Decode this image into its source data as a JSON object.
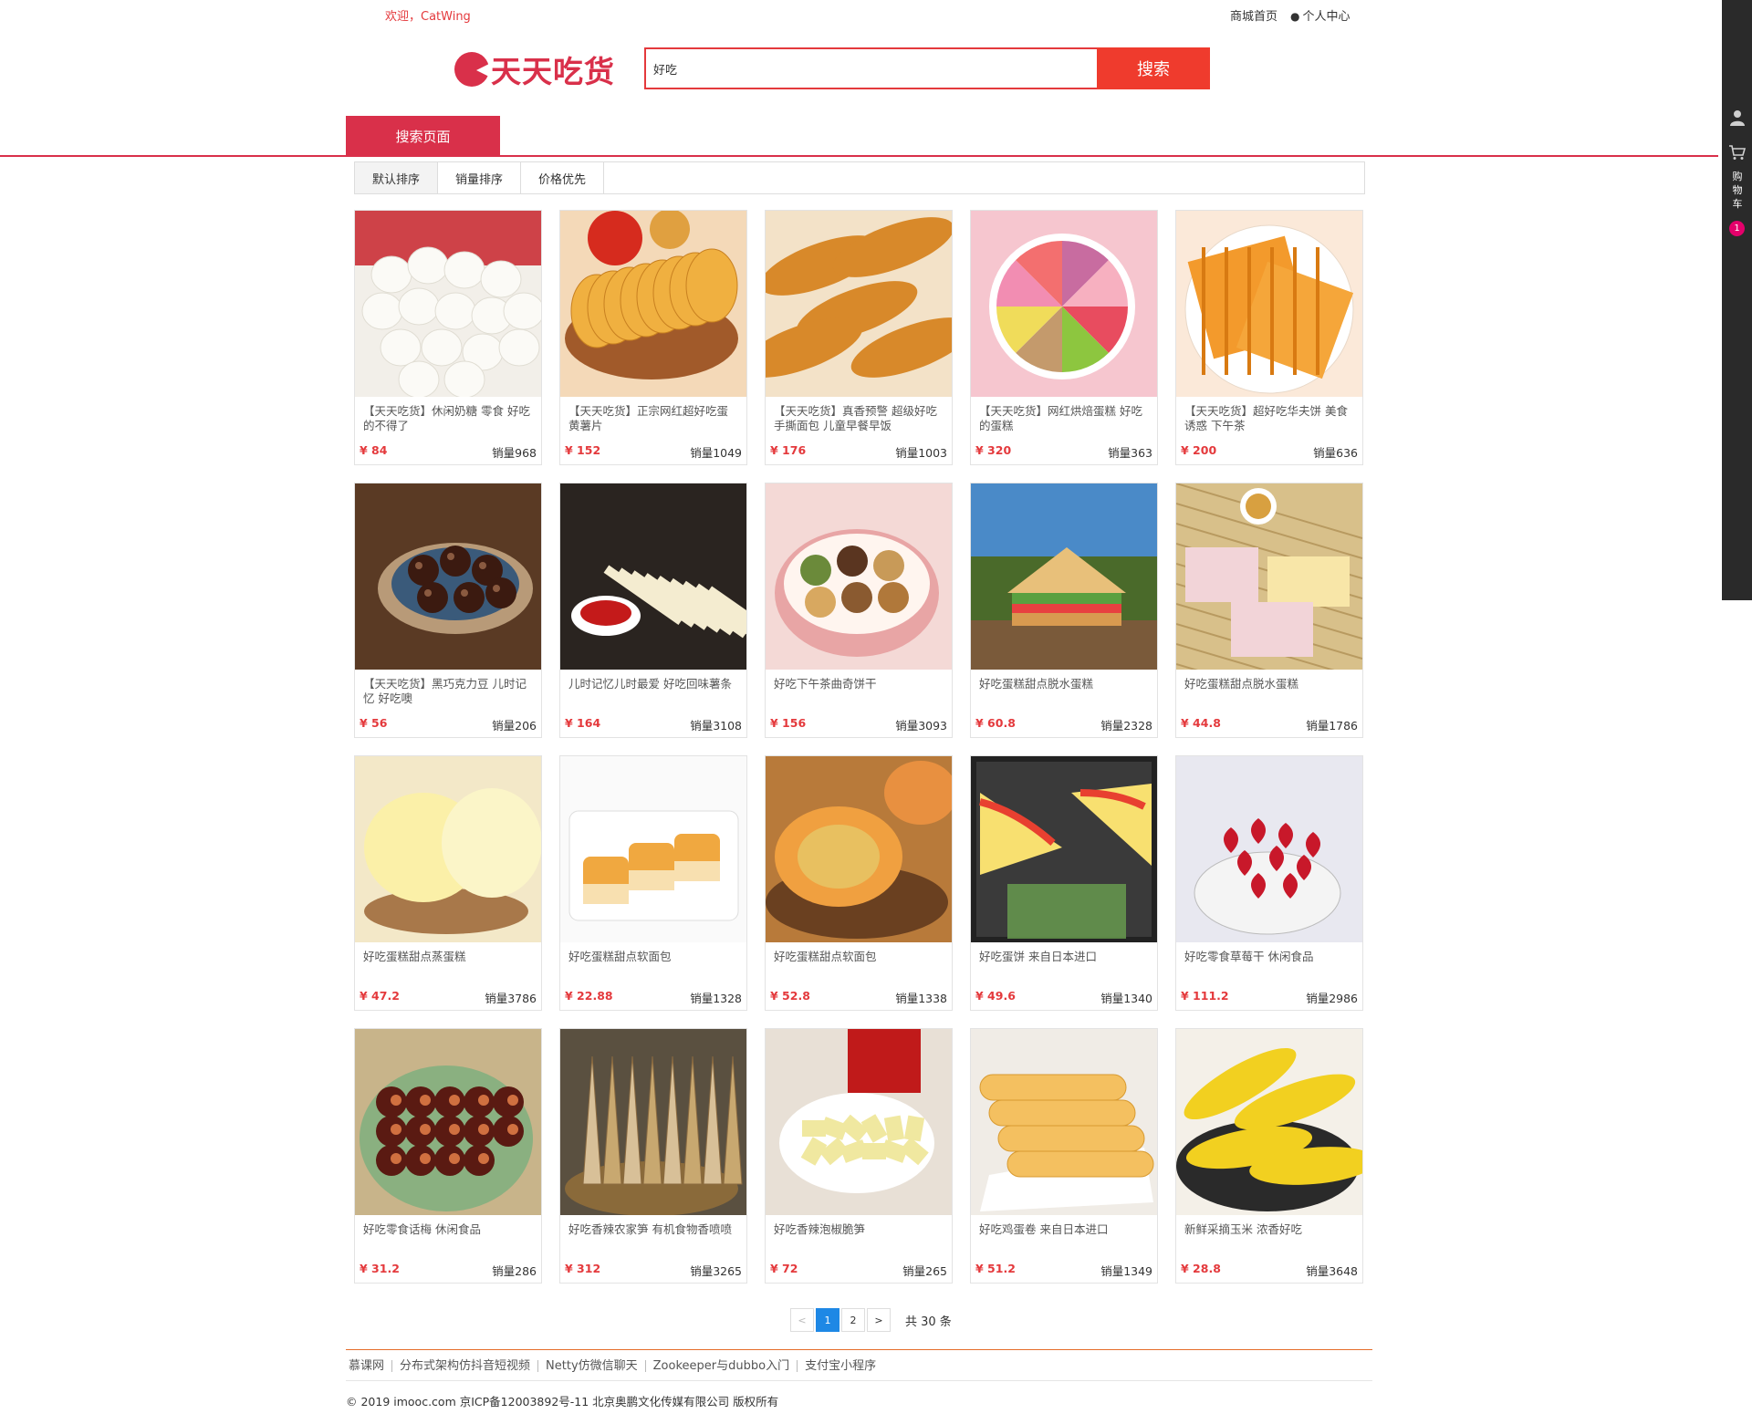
{
  "header": {
    "welcome": "欢迎，CatWing",
    "home_link": "商城首页",
    "user_center": "个人中心",
    "logo_text": "天天吃货"
  },
  "search": {
    "value": "好吃",
    "button_label": "搜索"
  },
  "nav": {
    "tab_label": "搜索页面"
  },
  "sort": {
    "options": [
      "默认排序",
      "销量排序",
      "价格优先"
    ],
    "active": "默认排序"
  },
  "products": [
    {
      "name": "【天天吃货】休闲奶糖 零食 好吃的不得了",
      "price": "¥ 84",
      "sales": "销量968",
      "image": "milk-candy"
    },
    {
      "name": "【天天吃货】正宗网红超好吃蛋黄薯片",
      "price": "¥ 152",
      "sales": "销量1049",
      "image": "chips"
    },
    {
      "name": "【天天吃货】真香预警 超级好吃 手撕面包 儿童早餐早饭",
      "price": "¥ 176",
      "sales": "销量1003",
      "image": "bread"
    },
    {
      "name": "【天天吃货】网红烘焙蛋糕 好吃的蛋糕",
      "price": "¥ 320",
      "sales": "销量363",
      "image": "rainbow-cake"
    },
    {
      "name": "【天天吃货】超好吃华夫饼 美食诱惑 下午茶",
      "price": "¥ 200",
      "sales": "销量636",
      "image": "waffle"
    },
    {
      "name": "【天天吃货】黑巧克力豆 儿时记忆 好吃噢",
      "price": "¥ 56",
      "sales": "销量206",
      "image": "chocolate-balls"
    },
    {
      "name": "儿时记忆儿时最爱 好吃回味薯条",
      "price": "¥ 164",
      "sales": "销量3108",
      "image": "fries"
    },
    {
      "name": "好吃下午茶曲奇饼干",
      "price": "¥ 156",
      "sales": "销量3093",
      "image": "cookies"
    },
    {
      "name": "好吃蛋糕甜点脱水蛋糕",
      "price": "¥ 60.8",
      "sales": "销量2328",
      "image": "sandwich"
    },
    {
      "name": "好吃蛋糕甜点脱水蛋糕",
      "price": "¥ 44.8",
      "sales": "销量1786",
      "image": "sponge-slices"
    },
    {
      "name": "好吃蛋糕甜点蒸蛋糕",
      "price": "¥ 47.2",
      "sales": "销量3786",
      "image": "steamed-cake"
    },
    {
      "name": "好吃蛋糕甜点软面包",
      "price": "¥ 22.88",
      "sales": "销量1328",
      "image": "muffins"
    },
    {
      "name": "好吃蛋糕甜点软面包",
      "price": "¥ 52.8",
      "sales": "销量1338",
      "image": "pastry"
    },
    {
      "name": "好吃蛋饼 来自日本进口",
      "price": "¥ 49.6",
      "sales": "销量1340",
      "image": "egg-pancake"
    },
    {
      "name": "好吃零食草莓干 休闲食品",
      "price": "¥ 111.2",
      "sales": "销量2986",
      "image": "dried-strawberry"
    },
    {
      "name": "好吃零食话梅 休闲食品",
      "price": "¥ 31.2",
      "sales": "销量286",
      "image": "plum"
    },
    {
      "name": "好吃香辣农家笋 有机食物香喷喷",
      "price": "¥ 312",
      "sales": "销量3265",
      "image": "bamboo-shoots"
    },
    {
      "name": "好吃香辣泡椒脆笋",
      "price": "¥ 72",
      "sales": "销量265",
      "image": "pickled-shoots"
    },
    {
      "name": "好吃鸡蛋卷 来自日本进口",
      "price": "¥ 51.2",
      "sales": "销量1349",
      "image": "egg-rolls"
    },
    {
      "name": "新鲜采摘玉米 浓香好吃",
      "price": "¥ 28.8",
      "sales": "销量3648",
      "image": "corn"
    }
  ],
  "pagination": {
    "prev": "<",
    "pages": [
      "1",
      "2"
    ],
    "current": "1",
    "next": ">",
    "total": "共 30 条"
  },
  "footer": {
    "links": [
      "慕课网",
      "分布式架构仿抖音短视频",
      "Netty仿微信聊天",
      "Zookeeper与dubbo入门",
      "支付宝小程序"
    ],
    "copyright": "© 2019 imooc.com 京ICP备12003892号-11 北京奥鹏文化传媒有限公司 版权所有"
  },
  "sidebar": {
    "cart_label": "购物车",
    "cart_count": "1"
  },
  "colors": {
    "brand": "#d9304a",
    "search_button": "#ef3b2d",
    "price": "#e4393c",
    "page_active": "#1e88e5",
    "sidebar": "#2a2a2a"
  }
}
